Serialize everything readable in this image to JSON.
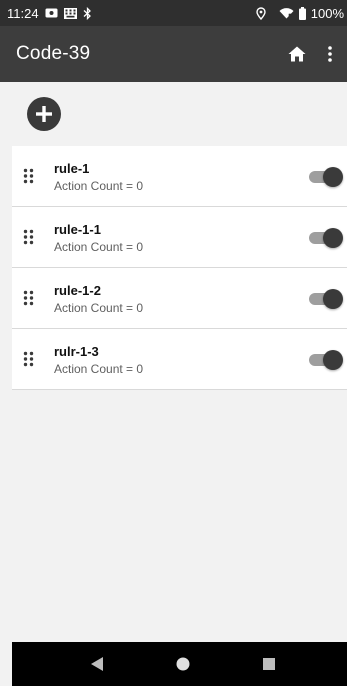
{
  "status_bar": {
    "time": "11:24",
    "battery": "100%",
    "icons": [
      "notification-card-icon",
      "keyboard-icon",
      "bluetooth-icon",
      "location-icon",
      "wifi-icon",
      "battery-icon"
    ]
  },
  "app_bar": {
    "title": "Code-39",
    "actions": [
      "home-icon",
      "more-vert-icon"
    ]
  },
  "add_button": {
    "icon": "plus-icon"
  },
  "rules": [
    {
      "name": "rule-1",
      "subtitle": "Action Count = 0",
      "enabled": true
    },
    {
      "name": "rule-1-1",
      "subtitle": "Action Count = 0",
      "enabled": true
    },
    {
      "name": "rule-1-2",
      "subtitle": "Action Count = 0",
      "enabled": true
    },
    {
      "name": "rulr-1-3",
      "subtitle": "Action Count = 0",
      "enabled": true
    }
  ],
  "nav_bar": {
    "buttons": [
      "back-icon",
      "home-icon",
      "recents-icon"
    ]
  },
  "colors": {
    "status_bar": "#2f2f2f",
    "app_bar": "#3d3d3d",
    "background": "#f2f2f2",
    "accent": "#3a3a3a",
    "toggle_track": "#9e9e9e"
  }
}
